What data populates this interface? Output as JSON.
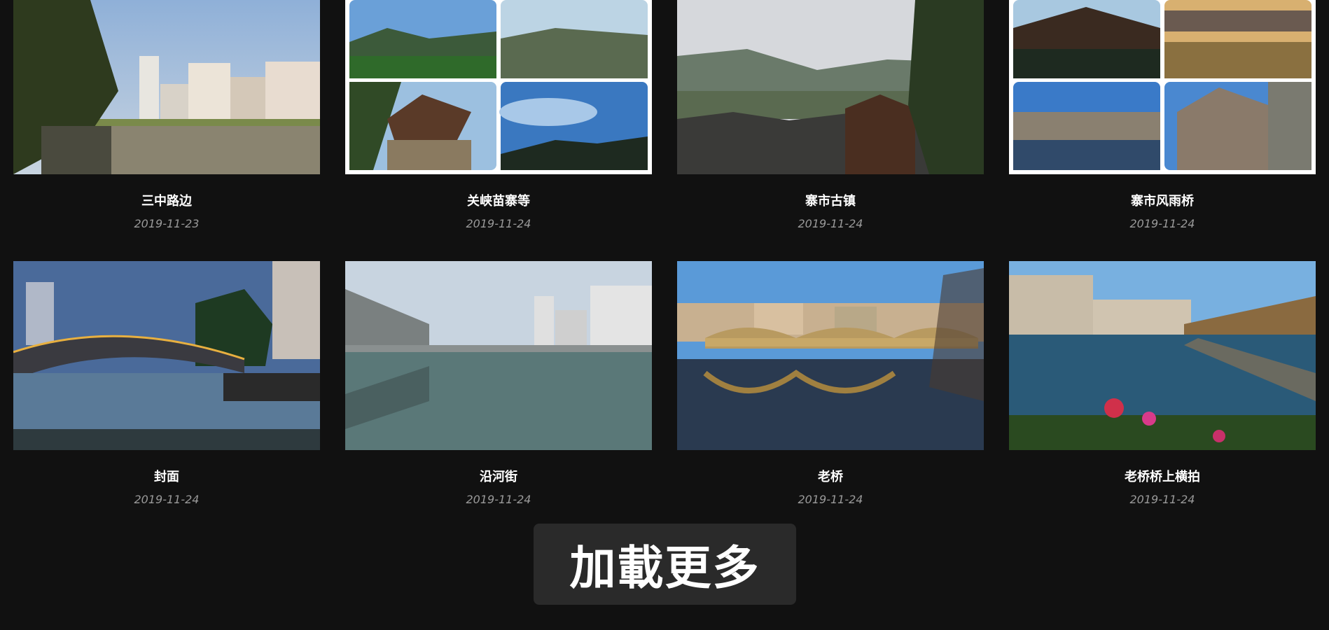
{
  "gallery": {
    "items": [
      {
        "title": "三中路边",
        "date": "2019-11-23",
        "image": "riverside-town-buildings"
      },
      {
        "title": "关峡苗寨等",
        "date": "2019-11-24",
        "image": "collage-lotus-pavilion-mountains"
      },
      {
        "title": "寨市古镇",
        "date": "2019-11-24",
        "image": "old-town-rooftops-misty-hills"
      },
      {
        "title": "寨市风雨桥",
        "date": "2019-11-24",
        "image": "collage-wind-rain-bridge-houses"
      },
      {
        "title": "封面",
        "date": "2019-11-24",
        "image": "illuminated-arch-bridge-dusk"
      },
      {
        "title": "沿河街",
        "date": "2019-11-24",
        "image": "riverside-street-reflections"
      },
      {
        "title": "老桥",
        "date": "2019-11-24",
        "image": "old-arch-bridge-reflection"
      },
      {
        "title": "老桥桥上横拍",
        "date": "2019-11-24",
        "image": "river-view-flowers-foreground"
      }
    ]
  },
  "load_more": {
    "label": "加載更多"
  },
  "colors": {
    "background": "#111111",
    "title": "#ffffff",
    "date": "#9a9a9a",
    "button_bg": "#2a2a2a"
  }
}
